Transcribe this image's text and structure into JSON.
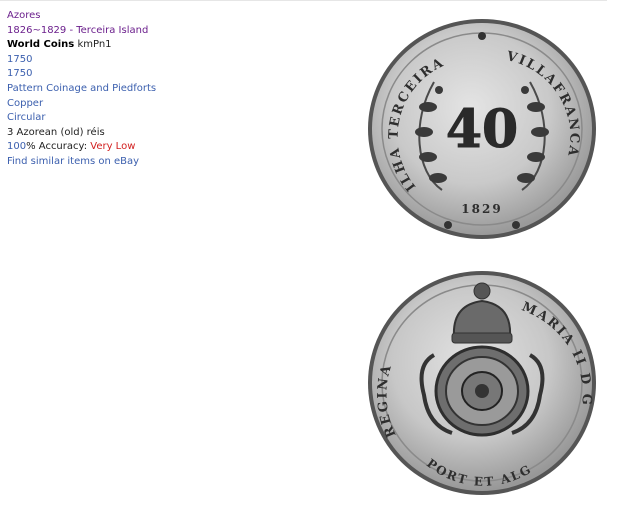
{
  "region": "Azores",
  "period": "1826~1829 - Terceira Island",
  "category": {
    "title": "World Coins",
    "code": "kmPn1"
  },
  "year_1": "1750",
  "year_2": "1750",
  "type": "Pattern Coinage and Piedforts",
  "material": "Copper",
  "shape": "Circular",
  "denomination": "3 Azorean (old) réis",
  "accuracy": {
    "percent": "100",
    "label": "% Accuracy: ",
    "value": "Very Low"
  },
  "ebay_link": "Find similar items on eBay",
  "coin_obverse": {
    "value_text": "40",
    "legend_left": "ILHA TERCEIRA",
    "legend_right": "VILLAFRANCA",
    "date": "1829"
  },
  "coin_reverse": {
    "legend_left": "REGINA",
    "legend_right": "MARIA II D G",
    "legend_bottom": "PORT ET ALG"
  },
  "colors": {
    "purple_link": "#6b1f8c",
    "blue_link": "#3b5fae",
    "accuracy_low": "#d22020"
  }
}
